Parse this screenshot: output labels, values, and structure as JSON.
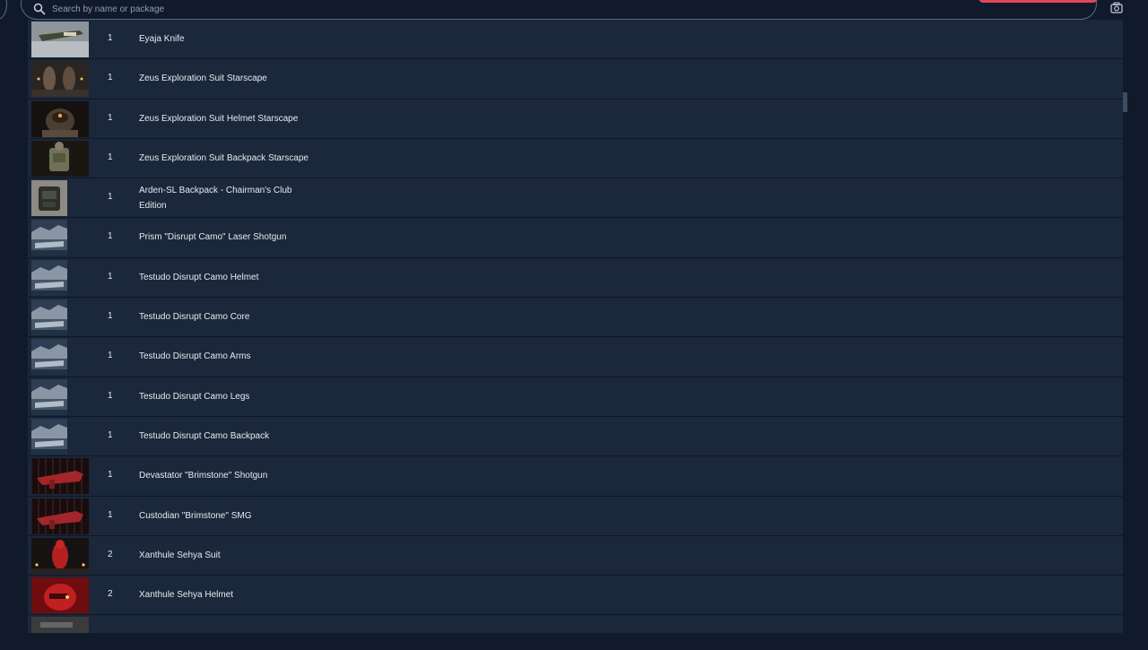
{
  "search": {
    "placeholder": "Search by name or package"
  },
  "colors": {
    "accent": "#e44659",
    "row_bg": "#1b273a",
    "page_bg": "#111a2b"
  },
  "items": [
    {
      "qty": "1",
      "name": "Eyaja Knife",
      "thumb": "knife"
    },
    {
      "qty": "1",
      "name": "Zeus Exploration Suit Starscape",
      "thumb": "suit-pair"
    },
    {
      "qty": "1",
      "name": "Zeus Exploration Suit Helmet Starscape",
      "thumb": "helmet"
    },
    {
      "qty": "1",
      "name": "Zeus Exploration Suit Backpack Starscape",
      "thumb": "backpack"
    },
    {
      "qty": "1",
      "name": "Arden-SL Backpack - Chairman's Club Edition",
      "thumb": "arden-backpack"
    },
    {
      "qty": "1",
      "name": "Prism \"Disrupt Camo\" Laser Shotgun",
      "thumb": "disrupt-camo"
    },
    {
      "qty": "1",
      "name": "Testudo Disrupt Camo Helmet",
      "thumb": "disrupt-camo"
    },
    {
      "qty": "1",
      "name": "Testudo Disrupt Camo Core",
      "thumb": "disrupt-camo"
    },
    {
      "qty": "1",
      "name": "Testudo Disrupt Camo Arms",
      "thumb": "disrupt-camo"
    },
    {
      "qty": "1",
      "name": "Testudo Disrupt Camo Legs",
      "thumb": "disrupt-camo"
    },
    {
      "qty": "1",
      "name": "Testudo Disrupt Camo Backpack",
      "thumb": "disrupt-camo"
    },
    {
      "qty": "1",
      "name": "Devastator \"Brimstone\" Shotgun",
      "thumb": "brimstone"
    },
    {
      "qty": "1",
      "name": "Custodian \"Brimstone\" SMG",
      "thumb": "brimstone"
    },
    {
      "qty": "2",
      "name": "Xanthule Sehya Suit",
      "thumb": "red-suit"
    },
    {
      "qty": "2",
      "name": "Xanthule Sehya Helmet",
      "thumb": "red-helmet"
    },
    {
      "qty": "",
      "name": "",
      "thumb": "partial"
    }
  ]
}
